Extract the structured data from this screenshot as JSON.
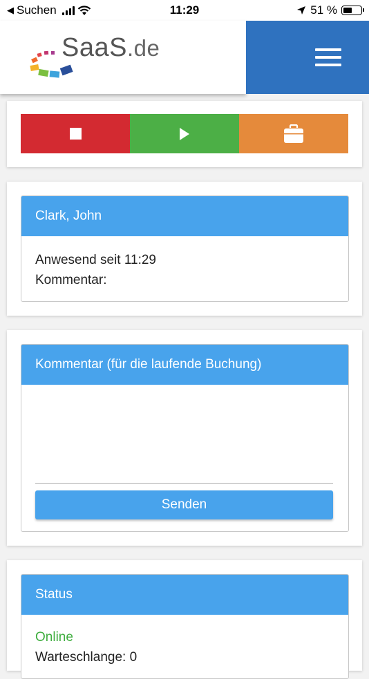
{
  "status_bar": {
    "back_label": "Suchen",
    "time": "11:29",
    "battery_text": "51 %",
    "battery_level": 0.51
  },
  "header": {
    "logo_name": "SaaS",
    "logo_tld": ".de",
    "menu_icon": "hamburger-icon"
  },
  "actions": [
    {
      "name": "stop",
      "icon": "stop-icon",
      "color": "#d32a31"
    },
    {
      "name": "start",
      "icon": "play-icon",
      "color": "#4caf46"
    },
    {
      "name": "business-trip",
      "icon": "briefcase-icon",
      "color": "#e58a3b"
    }
  ],
  "employee": {
    "name": "Clark, John",
    "presence": "Anwesend seit 11:29",
    "comment_label": "Kommentar:"
  },
  "comment_form": {
    "title": "Kommentar (für die laufende Buchung)",
    "value": "",
    "send_label": "Senden"
  },
  "status": {
    "title": "Status",
    "state": "Online",
    "queue": "Warteschlange: 0"
  },
  "colors": {
    "header_blue": "#2f72bf",
    "panel_blue": "#48a3ec",
    "online_green": "#3fae3f"
  }
}
